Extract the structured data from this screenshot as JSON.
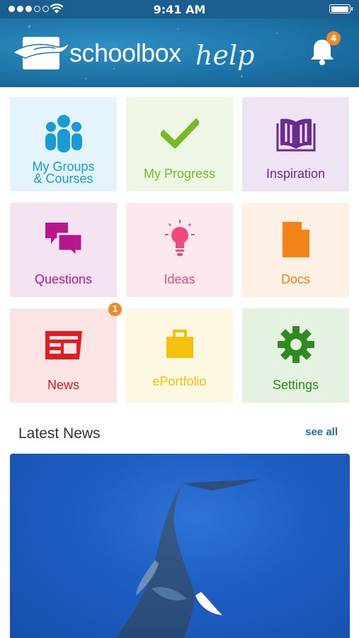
{
  "status_bar": {
    "time": "9:41 AM",
    "signal_bars_on": 3,
    "signal_bars_total": 5,
    "battery_level": 1.0
  },
  "header": {
    "brand": "schoolbox",
    "subtitle": "help",
    "notification_count": "4"
  },
  "tiles": [
    {
      "label_line1": "My Groups",
      "label_line2": "& Courses",
      "icon": "people-icon",
      "color": "#1a9ad6",
      "bg": "#e3f4fc"
    },
    {
      "label": "My Progress",
      "icon": "checkmark-icon",
      "color": "#7ab82a",
      "bg": "#eef7e4"
    },
    {
      "label": "Inspiration",
      "icon": "book-icon",
      "color": "#6a2c91",
      "bg": "#efe4f3"
    },
    {
      "label": "Questions",
      "icon": "speech-bubbles-icon",
      "color": "#b7178c",
      "bg": "#f6e3f1"
    },
    {
      "label": "Ideas",
      "icon": "lightbulb-icon",
      "color": "#ee4a7c",
      "bg": "#fde8ee"
    },
    {
      "label": "Docs",
      "icon": "document-icon",
      "color": "#f38318",
      "bg": "#fef0e4"
    },
    {
      "label": "News",
      "icon": "newspaper-icon",
      "color": "#e31b22",
      "bg": "#fde4e4",
      "badge": "1"
    },
    {
      "label": "ePortfolio",
      "icon": "briefcase-icon",
      "color": "#f4c20d",
      "bg": "#fdf8e2"
    },
    {
      "label": "Settings",
      "icon": "gear-icon",
      "color": "#2e8b1e",
      "bg": "#e6f2e1"
    }
  ],
  "latest_news": {
    "title": "Latest News",
    "see_all": "see all"
  }
}
